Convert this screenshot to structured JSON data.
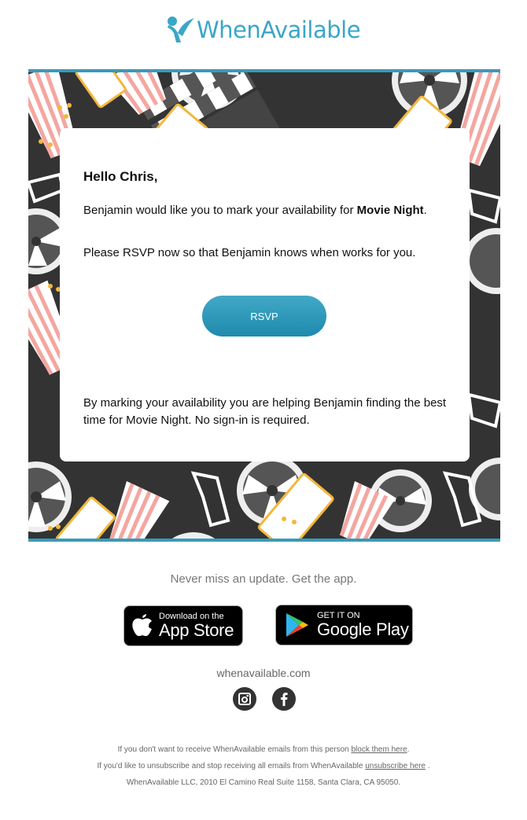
{
  "brand": {
    "name": "WhenAvailable",
    "color": "#3aa6c8"
  },
  "email": {
    "greeting": "Hello Chris,",
    "intro_prefix": "Benjamin would like you to mark your availability for ",
    "event_name": "Movie Night",
    "intro_suffix": ".",
    "rsvp_prompt": "Please RSVP now so that Benjamin knows when works for you.",
    "rsvp_button": "RSVP",
    "note": "By marking your availability you are helping Benjamin finding the best time for Movie Night. No sign-in is required.",
    "banner_theme": "cinema pattern: film reels, popcorn, cinema tickets, 3D glasses, clapperboards"
  },
  "colors": {
    "accent": "#3a9ab8",
    "button": "#2a97bb",
    "hero_bg": "#333333",
    "ticket": "#f3b73c",
    "popcorn_stripe": "#f4a6a0"
  },
  "apps": {
    "tagline": "Never miss an update. Get the app.",
    "appstore": {
      "small": "Download on the",
      "big": "App Store",
      "icon": "apple-icon"
    },
    "googleplay": {
      "small": "GET IT ON",
      "big": "Google Play",
      "icon": "google-play-icon"
    }
  },
  "footer": {
    "website": "whenavailable.com",
    "social": [
      {
        "name": "instagram",
        "icon": "instagram-icon"
      },
      {
        "name": "facebook",
        "icon": "facebook-icon"
      }
    ],
    "block_text": "If you don't want to receive WhenAvailable emails from this person ",
    "block_link": "block them here",
    "block_end": ".",
    "unsub_text": "If you'd like to unsubscribe and stop receiving all emails from WhenAvailable ",
    "unsub_link": "unsubscribe here",
    "unsub_end": " .",
    "address": "WhenAvailable LLC, 2010 El Camino Real Suite 1158, Santa Clara, CA 95050."
  }
}
